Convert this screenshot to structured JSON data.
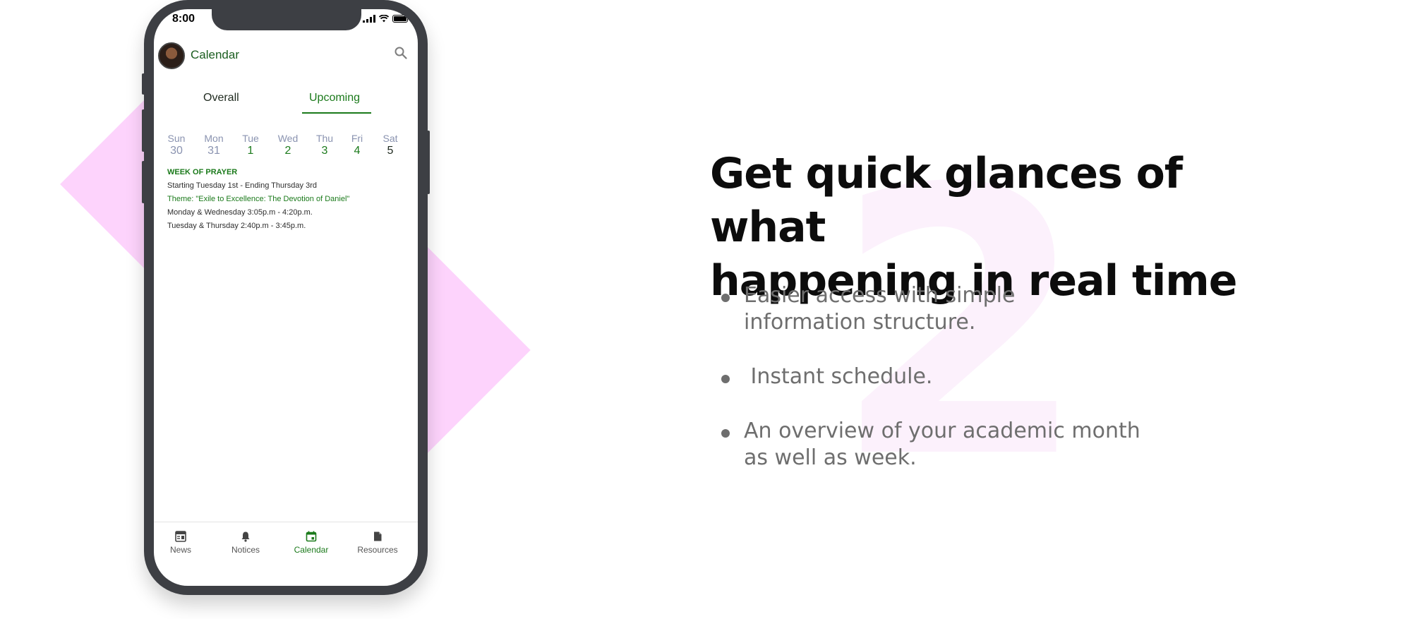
{
  "phone": {
    "status_time": "8:00",
    "app_title": "Calendar",
    "tabs": [
      "Overall",
      "Upcoming"
    ],
    "active_tab": "Upcoming",
    "week": [
      {
        "day": "Sun",
        "date": "30",
        "color": "#8a93b0"
      },
      {
        "day": "Mon",
        "date": "31",
        "color": "#8a93b0"
      },
      {
        "day": "Tue",
        "date": "1",
        "color": "#1b7a1b"
      },
      {
        "day": "Wed",
        "date": "2",
        "color": "#1b7a1b"
      },
      {
        "day": "Thu",
        "date": "3",
        "color": "#1b7a1b"
      },
      {
        "day": "Fri",
        "date": "4",
        "color": "#1b7a1b"
      },
      {
        "day": "Sat",
        "date": "5",
        "color": "#1f2a1f"
      }
    ],
    "events": {
      "heading": "WEEK OF PRAYER",
      "dates": "Starting Tuesday 1st - Ending Thursday 3rd",
      "theme": "Theme: \"Exile to Excellence: The Devotion of Daniel\"",
      "slot1": "Monday & Wednesday  3:05p.m - 4:20p.m.",
      "slot2": "Tuesday & Thursday  2:40p.m - 3:45p.m."
    },
    "nav": [
      {
        "label": "News",
        "icon": "newspaper-icon"
      },
      {
        "label": "Notices",
        "icon": "bell-icon"
      },
      {
        "label": "Calendar",
        "icon": "calendar-icon"
      },
      {
        "label": "Resources",
        "icon": "document-icon"
      }
    ],
    "active_nav": "Calendar"
  },
  "marketing": {
    "headline_line1": "Get quick glances of what",
    "headline_line2": "happening in real time",
    "bullets": [
      "Easier access with simple information structure.",
      " Instant schedule.",
      "An overview of your academic month as well as week."
    ],
    "background_numeral": "2"
  },
  "colors": {
    "accent_green": "#1b7a1b",
    "pink_shape": "#fdd3fc",
    "phone_frame": "#3d3f44"
  }
}
